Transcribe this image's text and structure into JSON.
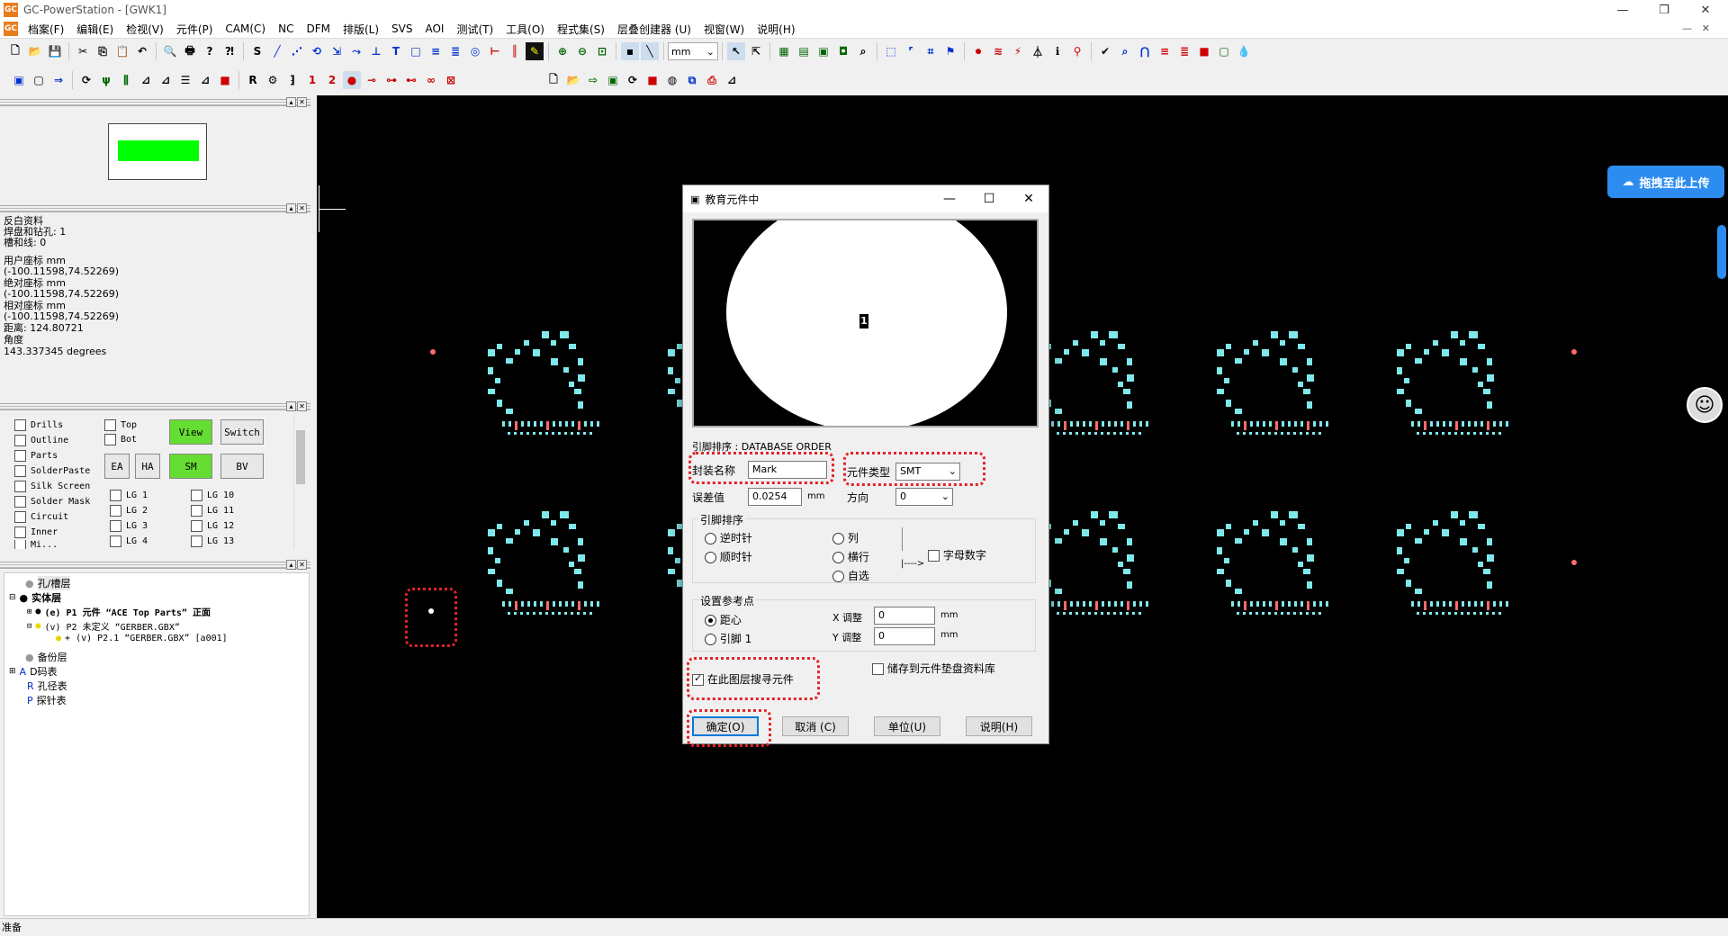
{
  "window": {
    "title": "GC-PowerStation - [GWK1]",
    "icon_text": "GC"
  },
  "menu": [
    "档案(F)",
    "编辑(E)",
    "检视(V)",
    "元件(P)",
    "CAM(C)",
    "NC",
    "DFM",
    "排版(L)",
    "SVS",
    "AOI",
    "测试(T)",
    "工具(O)",
    "程式集(S)",
    "层叠创建器 (U)",
    "视窗(W)",
    "说明(H)"
  ],
  "toolbar": {
    "unit_value": "mm"
  },
  "info": {
    "lines": [
      "反白资料",
      " 焊盘和钻孔: 1",
      " 槽和线: 0",
      "用户座标 mm",
      " (-100.11598,74.52269)",
      "绝对座标 mm",
      " (-100.11598,74.52269)",
      "相对座标 mm",
      " (-100.11598,74.52269)",
      " 距离: 124.80721",
      "角度",
      " 143.337345 degrees"
    ]
  },
  "layers": {
    "left": [
      "Drills",
      "Outline",
      "Parts",
      "SolderPaste",
      "Silk Screen",
      "Solder Mask",
      "Circuit",
      "Inner",
      "Mi..."
    ],
    "sides": [
      "Top",
      "Bot"
    ],
    "buttons": {
      "view": "View",
      "switch": "Switch",
      "ea": "EA",
      "ha": "HA",
      "sm": "SM",
      "bv": "BV"
    },
    "lg_col1": [
      "LG 1",
      "LG 2",
      "LG 3",
      "LG 4"
    ],
    "lg_col2": [
      "LG 10",
      "LG 11",
      "LG 12",
      "LG 13"
    ]
  },
  "tree": {
    "holes": "孔/槽层",
    "solid": "实体层",
    "p1": "(e) P1 元件 “ACE Top Parts” 正面",
    "p2": "(v) P2 未定义 “GERBER.GBX”",
    "p21": "+ (v) P2.1 “GERBER.GBX” [a001]",
    "backup": "备份层",
    "dcode": "D码表",
    "hole_table": "孔径表",
    "probe_table": "探针表"
  },
  "status": "准备",
  "dialog": {
    "title": "教育元件中",
    "preview_label": "1",
    "pin_order": "引脚排序 : DATABASE ORDER",
    "package_label": "封装名称",
    "package_value": "Mark",
    "type_label": "元件类型",
    "type_value": "SMT",
    "tolerance_label": "误差值",
    "tolerance_value": "0.0254",
    "tolerance_unit": "mm",
    "direction_label": "方向",
    "direction_value": "0",
    "pin_group": "引脚排序",
    "ccw": "逆时针",
    "cw": "顺时针",
    "column": "列",
    "row": "横行",
    "auto": "自选",
    "alpha": "字母数字",
    "arrow": "|---->",
    "ref_group": "设置参考点",
    "centroid": "距心",
    "pin1": "引脚 1",
    "x_adj_label": "X 调整",
    "x_adj_value": "0",
    "y_adj_label": "Y 调整",
    "y_adj_value": "0",
    "adj_unit": "mm",
    "save_pad": "储存到元件垫盘资料库",
    "search_layer": "在此图层搜寻元件",
    "ok": "确定(O)",
    "cancel": "取消 (C)",
    "unit": "单位(U)",
    "help": "说明(H)"
  },
  "upload": {
    "label": "拖拽至此上传"
  }
}
